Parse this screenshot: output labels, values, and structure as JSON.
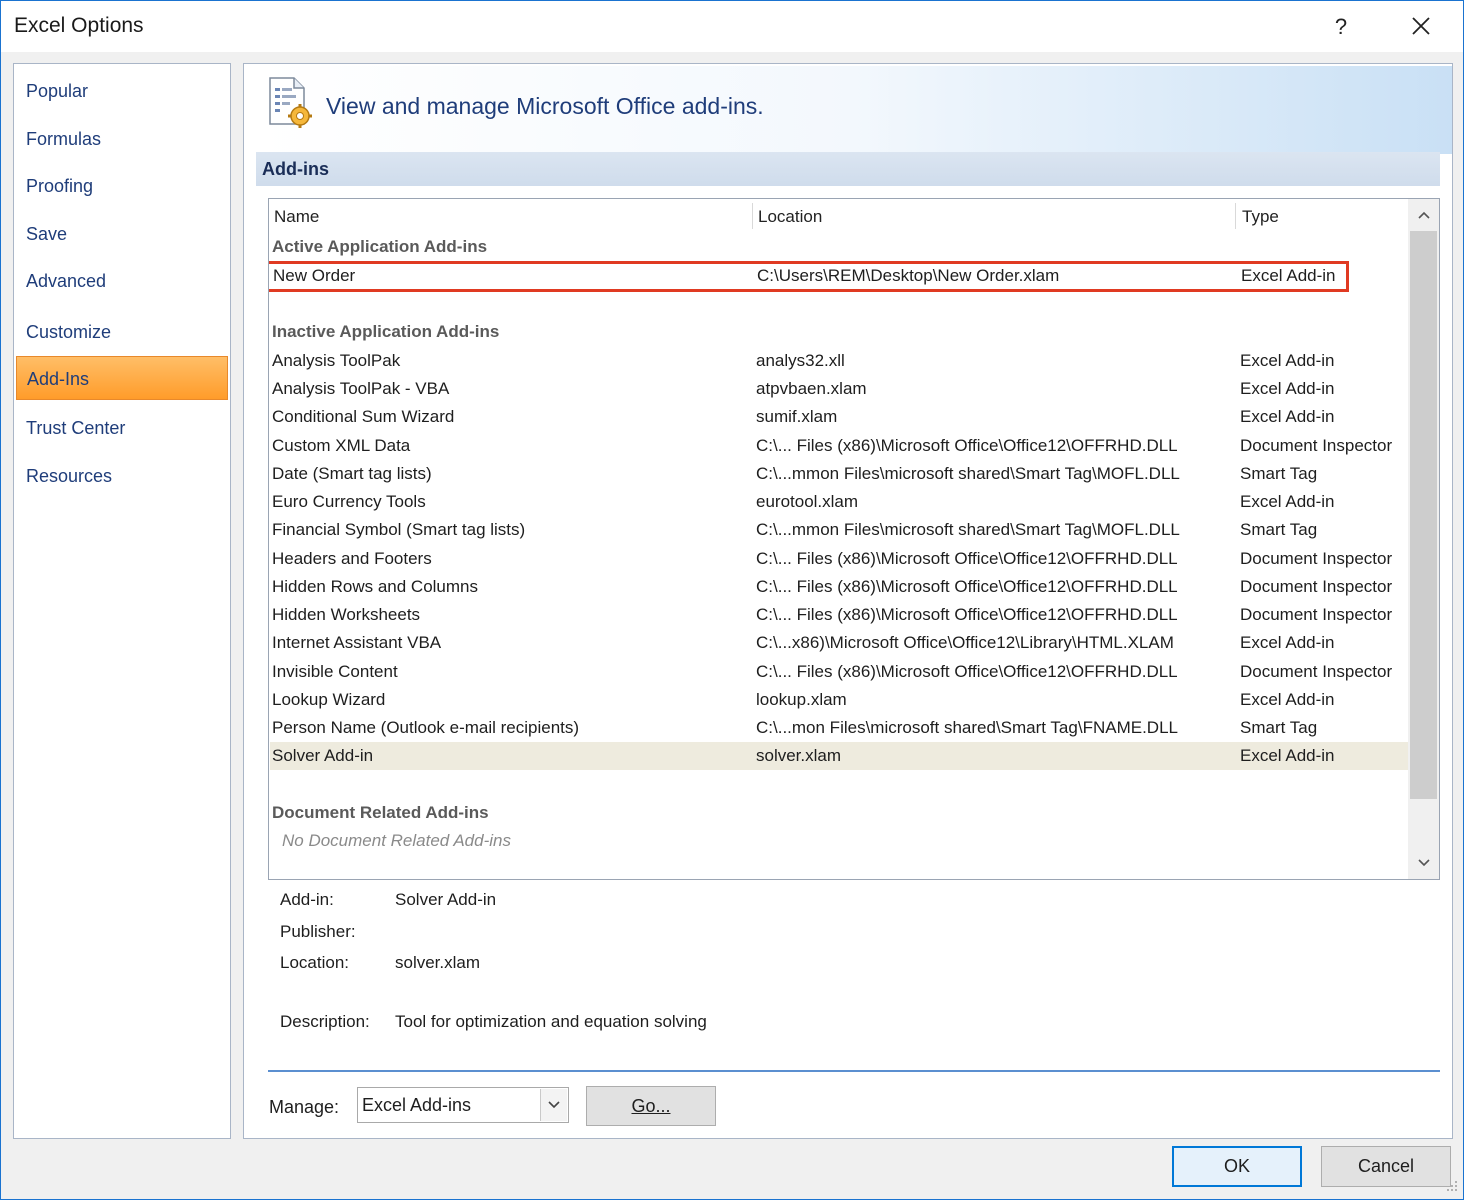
{
  "window": {
    "title": "Excel Options",
    "help_label": "?"
  },
  "sidebar": {
    "items": [
      {
        "label": "Popular"
      },
      {
        "label": "Formulas"
      },
      {
        "label": "Proofing"
      },
      {
        "label": "Save"
      },
      {
        "label": "Advanced"
      },
      {
        "label": "Customize"
      },
      {
        "label": "Add-Ins",
        "active": true
      },
      {
        "label": "Trust Center"
      },
      {
        "label": "Resources"
      }
    ]
  },
  "main": {
    "banner_text": "View and manage Microsoft Office add-ins.",
    "section_title": "Add-ins",
    "columns": [
      "Name",
      "Location",
      "Type"
    ],
    "groups": {
      "active": "Active Application Add-ins",
      "inactive": "Inactive Application Add-ins",
      "document": "Document Related Add-ins",
      "document_empty": "No Document Related Add-ins"
    },
    "active_rows": [
      {
        "name": "New Order",
        "location": "C:\\Users\\REM\\Desktop\\New Order.xlam",
        "type": "Excel Add-in"
      }
    ],
    "inactive_rows": [
      {
        "name": "Analysis ToolPak",
        "location": "analys32.xll",
        "type": "Excel Add-in"
      },
      {
        "name": "Analysis ToolPak - VBA",
        "location": "atpvbaen.xlam",
        "type": "Excel Add-in"
      },
      {
        "name": "Conditional Sum Wizard",
        "location": "sumif.xlam",
        "type": "Excel Add-in"
      },
      {
        "name": "Custom XML Data",
        "location": "C:\\... Files (x86)\\Microsoft Office\\Office12\\OFFRHD.DLL",
        "type": "Document Inspector"
      },
      {
        "name": "Date (Smart tag lists)",
        "location": "C:\\...mmon Files\\microsoft shared\\Smart Tag\\MOFL.DLL",
        "type": "Smart Tag"
      },
      {
        "name": "Euro Currency Tools",
        "location": "eurotool.xlam",
        "type": "Excel Add-in"
      },
      {
        "name": "Financial Symbol (Smart tag lists)",
        "location": "C:\\...mmon Files\\microsoft shared\\Smart Tag\\MOFL.DLL",
        "type": "Smart Tag"
      },
      {
        "name": "Headers and Footers",
        "location": "C:\\... Files (x86)\\Microsoft Office\\Office12\\OFFRHD.DLL",
        "type": "Document Inspector"
      },
      {
        "name": "Hidden Rows and Columns",
        "location": "C:\\... Files (x86)\\Microsoft Office\\Office12\\OFFRHD.DLL",
        "type": "Document Inspector"
      },
      {
        "name": "Hidden Worksheets",
        "location": "C:\\... Files (x86)\\Microsoft Office\\Office12\\OFFRHD.DLL",
        "type": "Document Inspector"
      },
      {
        "name": "Internet Assistant VBA",
        "location": "C:\\...x86)\\Microsoft Office\\Office12\\Library\\HTML.XLAM",
        "type": "Excel Add-in"
      },
      {
        "name": "Invisible Content",
        "location": "C:\\... Files (x86)\\Microsoft Office\\Office12\\OFFRHD.DLL",
        "type": "Document Inspector"
      },
      {
        "name": "Lookup Wizard",
        "location": "lookup.xlam",
        "type": "Excel Add-in"
      },
      {
        "name": "Person Name (Outlook e-mail recipients)",
        "location": "C:\\...mon Files\\microsoft shared\\Smart Tag\\FNAME.DLL",
        "type": "Smart Tag"
      },
      {
        "name": "Solver Add-in",
        "location": "solver.xlam",
        "type": "Excel Add-in",
        "selected": true
      }
    ],
    "details": {
      "addin_label": "Add-in:",
      "addin_value": "Solver Add-in",
      "publisher_label": "Publisher:",
      "location_label": "Location:",
      "location_value": "solver.xlam",
      "description_label": "Description:",
      "description_value": "Tool for optimization and equation solving"
    },
    "manage": {
      "label": "Manage:",
      "selected": "Excel Add-ins",
      "go_label": "Go..."
    }
  },
  "footer": {
    "ok_label": "OK",
    "cancel_label": "Cancel"
  },
  "colors": {
    "accent": "#0078d7",
    "active_nav": "#ff9c2a",
    "highlight_border": "#e03a22",
    "selected_row": "#eeebde"
  }
}
